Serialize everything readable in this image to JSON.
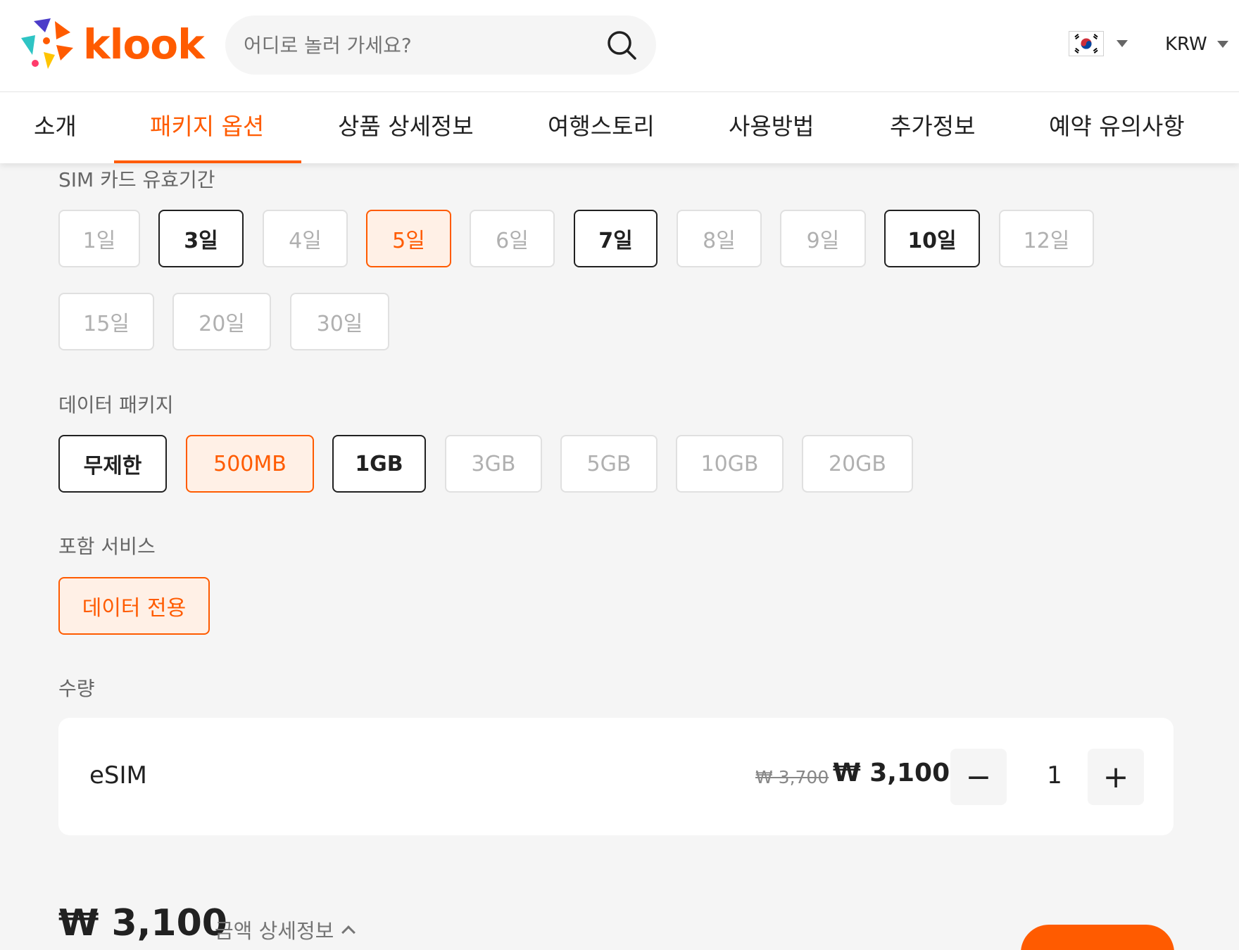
{
  "header": {
    "logo_text": "klook",
    "search_placeholder": "어디로 놀러 가세요?",
    "language_flag": "korea-flag-icon",
    "currency": "KRW"
  },
  "tabs": [
    {
      "label": "소개",
      "active": false
    },
    {
      "label": "패키지 옵션",
      "active": true
    },
    {
      "label": "상품 상세정보",
      "active": false
    },
    {
      "label": "여행스토리",
      "active": false
    },
    {
      "label": "사용방법",
      "active": false
    },
    {
      "label": "추가정보",
      "active": false
    },
    {
      "label": "예약 유의사항",
      "active": false
    }
  ],
  "validity": {
    "label": "SIM 카드 유효기간",
    "options": [
      {
        "label": "1일",
        "state": "disabled"
      },
      {
        "label": "3일",
        "state": "available"
      },
      {
        "label": "4일",
        "state": "disabled"
      },
      {
        "label": "5일",
        "state": "selected"
      },
      {
        "label": "6일",
        "state": "disabled"
      },
      {
        "label": "7일",
        "state": "available"
      },
      {
        "label": "8일",
        "state": "disabled"
      },
      {
        "label": "9일",
        "state": "disabled"
      },
      {
        "label": "10일",
        "state": "available"
      },
      {
        "label": "12일",
        "state": "disabled"
      },
      {
        "label": "15일",
        "state": "disabled"
      },
      {
        "label": "20일",
        "state": "disabled"
      },
      {
        "label": "30일",
        "state": "disabled"
      }
    ]
  },
  "data_package": {
    "label": "데이터 패키지",
    "options": [
      {
        "label": "무제한",
        "state": "available"
      },
      {
        "label": "500MB",
        "state": "selected"
      },
      {
        "label": "1GB",
        "state": "available"
      },
      {
        "label": "3GB",
        "state": "disabled"
      },
      {
        "label": "5GB",
        "state": "disabled"
      },
      {
        "label": "10GB",
        "state": "disabled"
      },
      {
        "label": "20GB",
        "state": "disabled"
      }
    ]
  },
  "service": {
    "label": "포함 서비스",
    "options": [
      {
        "label": "데이터 전용",
        "state": "selected"
      }
    ]
  },
  "quantity": {
    "label": "수량",
    "item_name": "eSIM",
    "original_price": "₩ 3,700",
    "price": "₩ 3,100",
    "minus": "−",
    "value": "1",
    "plus": "+"
  },
  "footer": {
    "total": "₩ 3,100",
    "detail_link": "금액 상세정보"
  },
  "colors": {
    "brand": "#ff5b00",
    "selected_bg": "#fff0e6",
    "disabled_text": "#b0b0b0"
  }
}
